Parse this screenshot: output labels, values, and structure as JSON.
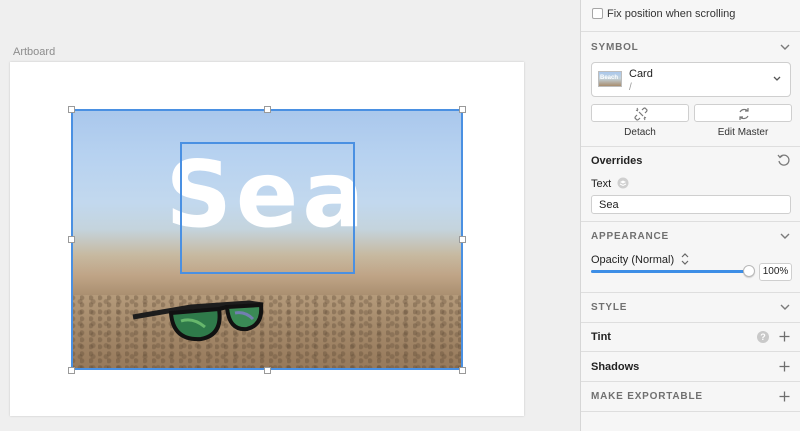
{
  "canvas": {
    "artboard_label": "Artboard",
    "symbol_text": "Sea"
  },
  "inspector": {
    "fix_position_label": "Fix position when scrolling",
    "fix_position_checked": false,
    "symbol": {
      "title": "SYMBOL",
      "name": "Card",
      "path": "/",
      "thumbnail_text": "Beach",
      "detach_label": "Detach",
      "edit_master_label": "Edit Master"
    },
    "overrides": {
      "title": "Overrides",
      "text_label": "Text",
      "text_value": "Sea"
    },
    "appearance": {
      "title": "APPEARANCE",
      "opacity_label": "Opacity (Normal)",
      "opacity_value": "100%",
      "opacity_fraction": 1.0
    },
    "style": {
      "title": "STYLE"
    },
    "tint": {
      "title": "Tint",
      "help": "?"
    },
    "shadows": {
      "title": "Shadows"
    },
    "exportable": {
      "title": "MAKE EXPORTABLE"
    }
  },
  "colors": {
    "selection": "#4a90e2",
    "slider_fill": "#3d8ee6"
  }
}
